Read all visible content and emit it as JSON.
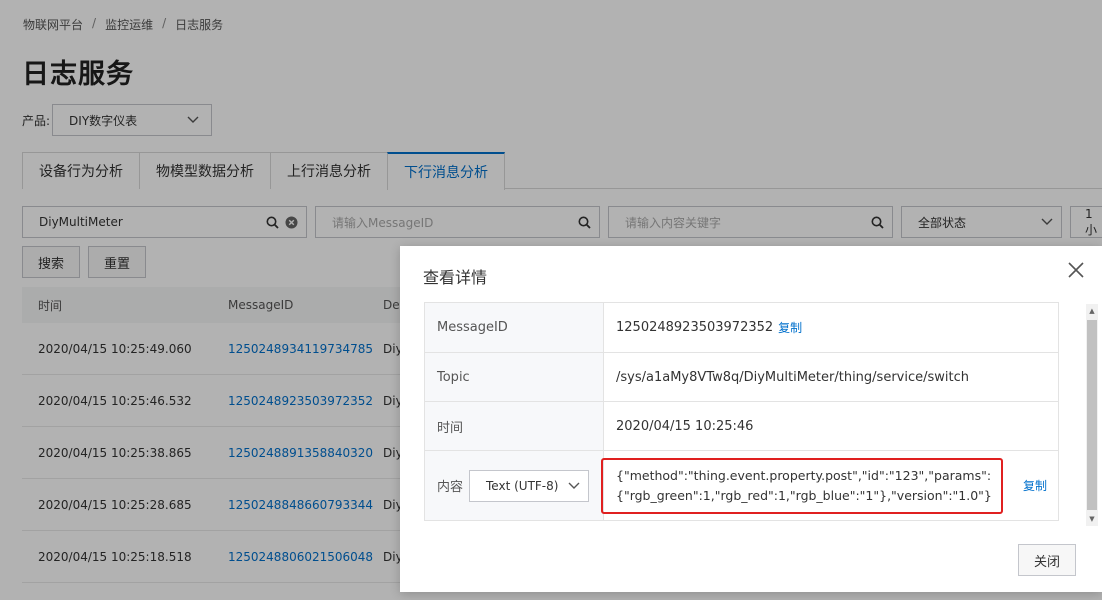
{
  "breadcrumb": {
    "items": [
      "物联网平台",
      "监控运维",
      "日志服务"
    ],
    "sep": "/"
  },
  "page_title": "日志服务",
  "product": {
    "label": "产品:",
    "value": "DIY数字仪表"
  },
  "tabs": [
    {
      "label": "设备行为分析"
    },
    {
      "label": "物模型数据分析"
    },
    {
      "label": "上行消息分析"
    },
    {
      "label": "下行消息分析"
    }
  ],
  "filters": {
    "device_value": "DiyMultiMeter",
    "messageid_placeholder": "请输入MessageID",
    "keyword_placeholder": "请输入内容关键字",
    "status_value": "全部状态",
    "time_value": "1小"
  },
  "buttons": {
    "search": "搜索",
    "reset": "重置"
  },
  "table": {
    "headers": [
      "时间",
      "MessageID",
      "De"
    ],
    "rows": [
      {
        "time": "2020/04/15 10:25:49.060",
        "id": "1250248934119734785",
        "dev": "Diy"
      },
      {
        "time": "2020/04/15 10:25:46.532",
        "id": "1250248923503972352",
        "dev": "Diy"
      },
      {
        "time": "2020/04/15 10:25:38.865",
        "id": "1250248891358840320",
        "dev": "Diy"
      },
      {
        "time": "2020/04/15 10:25:28.685",
        "id": "1250248848660793344",
        "dev": "Diy"
      },
      {
        "time": "2020/04/15 10:25:18.518",
        "id": "1250248806021506048",
        "dev": "Diy"
      }
    ]
  },
  "modal": {
    "title": "查看详情",
    "rows": {
      "messageid_label": "MessageID",
      "messageid_value": "1250248923503972352",
      "topic_label": "Topic",
      "topic_value": "/sys/a1aMy8VTw8q/DiyMultiMeter/thing/service/switch",
      "time_label": "时间",
      "time_value": "2020/04/15 10:25:46",
      "content_label": "内容",
      "encoding_value": "Text (UTF-8)",
      "content_line1": "{\"method\":\"thing.event.property.post\",\"id\":\"123\",\"params\":",
      "content_line2": "{\"rgb_green\":1,\"rgb_red\":1,\"rgb_blue\":\"1\"},\"version\":\"1.0\"}"
    },
    "copy_label": "复制",
    "close_label": "关闭"
  },
  "colors": {
    "accent": "#0070cc",
    "highlight": "#e02020"
  }
}
